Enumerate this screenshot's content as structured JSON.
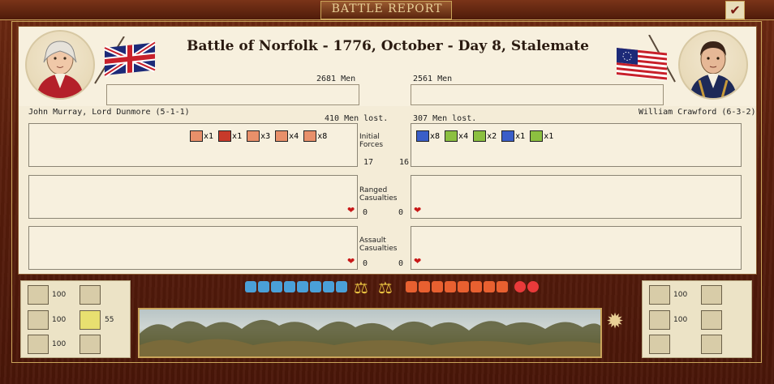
{
  "window": {
    "title": "BATTLE REPORT",
    "ok_icon": "checkmark-icon"
  },
  "battle": {
    "title": "Battle of Norfolk - 1776, October - Day 8, Stalemate"
  },
  "left": {
    "commander": "John Murray, Lord Dunmore (5-1-1)",
    "men": "2681 Men",
    "lost": "410 Men lost.",
    "forces_count": "17",
    "ranged_value": "0",
    "assault_value": "0",
    "units": [
      {
        "icon": "cavalry-unit-icon",
        "color": "#e8906a",
        "count": "x1"
      },
      {
        "icon": "artillery-unit-icon",
        "color": "#c83a2a",
        "count": "x1"
      },
      {
        "icon": "militia-unit-icon",
        "color": "#e8906a",
        "count": "x3"
      },
      {
        "icon": "militia-unit-icon",
        "color": "#e8906a",
        "count": "x4"
      },
      {
        "icon": "militia-unit-icon",
        "color": "#e8906a",
        "count": "x8"
      }
    ]
  },
  "right": {
    "commander": "William Crawford (6-3-2)",
    "men": "2561 Men",
    "lost": "307 Men lost.",
    "forces_count": "16",
    "ranged_value": "0",
    "assault_value": "0",
    "units": [
      {
        "icon": "infantry-unit-icon",
        "color": "#3a5ec8",
        "count": "x8"
      },
      {
        "icon": "militia-unit-icon",
        "color": "#8cc040",
        "count": "x4"
      },
      {
        "icon": "militia-unit-icon",
        "color": "#8cc040",
        "count": "x2"
      },
      {
        "icon": "infantry-unit-icon",
        "color": "#3a5ec8",
        "count": "x1"
      },
      {
        "icon": "artillery-unit-icon",
        "color": "#8cc040",
        "count": "x1"
      }
    ]
  },
  "labels": {
    "initial": "Initial",
    "forces": "Forces",
    "ranged": "Ranged",
    "ranged_cas": "Casualties",
    "assault": "Assault",
    "assault_cas": "Casualties"
  },
  "bottom_left": {
    "supply": "100",
    "ammo": "100",
    "fort": "100",
    "move": "55"
  },
  "bottom_right": {
    "supply": "100",
    "ammo": "100"
  }
}
